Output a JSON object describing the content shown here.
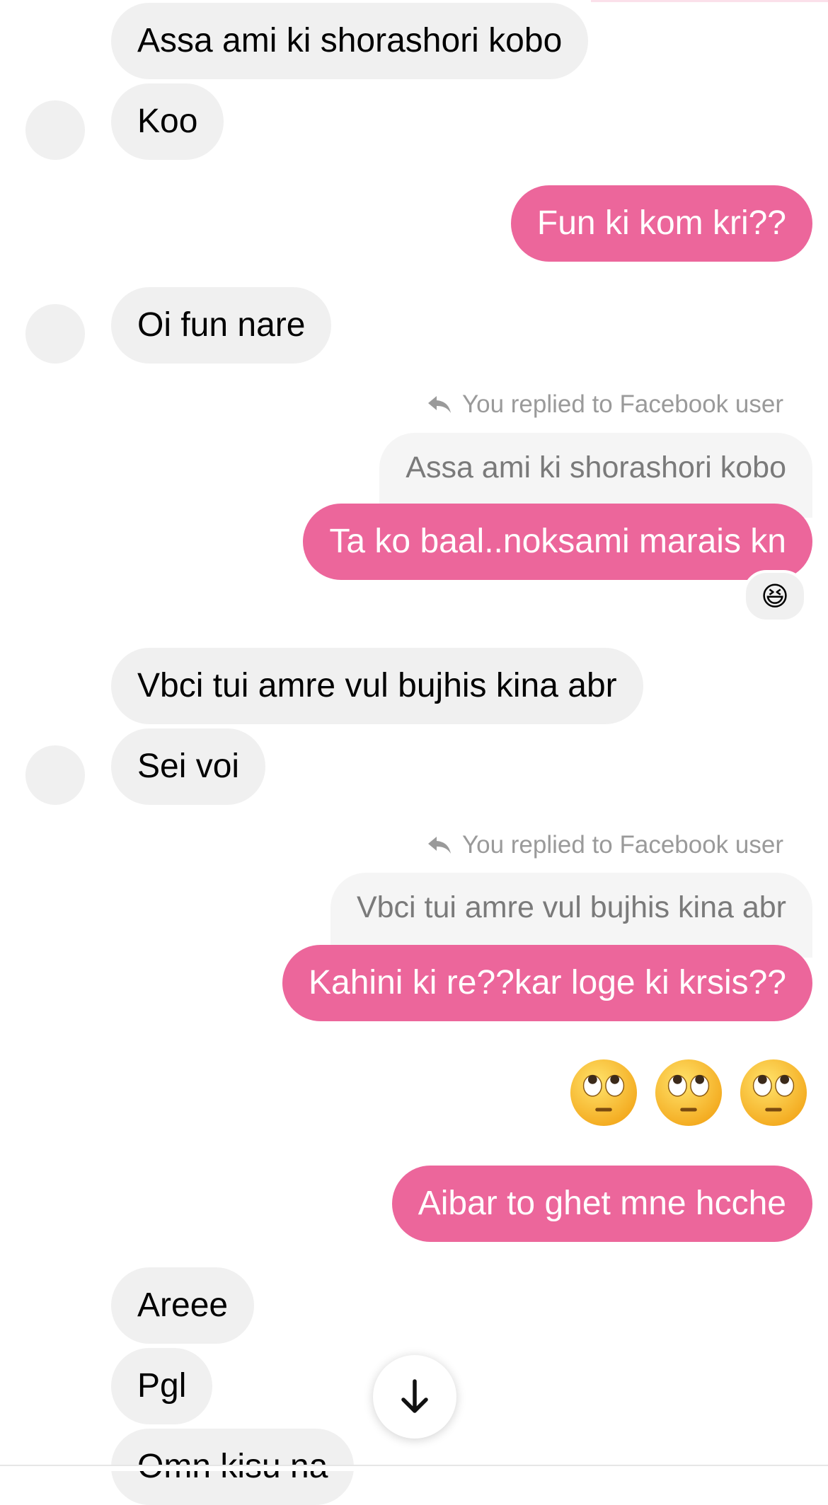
{
  "messages": {
    "m1": "Assa ami ki shorashori kobo",
    "m2": "Koo",
    "m3": "Fun ki kom kri??",
    "m4": "Oi fun nare",
    "reply1": {
      "label": "You replied to Facebook user",
      "quote": "Assa ami ki shorashori kobo",
      "text": "Ta ko baal..noksami marais kn",
      "reaction": "😆"
    },
    "m6": "Vbci tui amre vul bujhis kina abr",
    "m7": "Sei voi",
    "reply2": {
      "label": "You replied to Facebook user",
      "quote": "Vbci tui amre vul bujhis kina abr",
      "text": "Kahini ki re??kar loge ki krsis??"
    },
    "emojis": [
      "face-with-rolling-eyes",
      "face-with-rolling-eyes",
      "face-with-rolling-eyes"
    ],
    "m9": "Aibar to ghet mne hcche",
    "m10": "Areee",
    "m11": "Pgl",
    "m12": "Omn kisu na"
  },
  "colors": {
    "outgoing": "#ec669b",
    "incoming": "#f0f0f0",
    "reply_label": "#9a9a9a"
  },
  "icons": {
    "reply": "reply-arrow-icon",
    "scroll": "arrow-down-icon"
  }
}
